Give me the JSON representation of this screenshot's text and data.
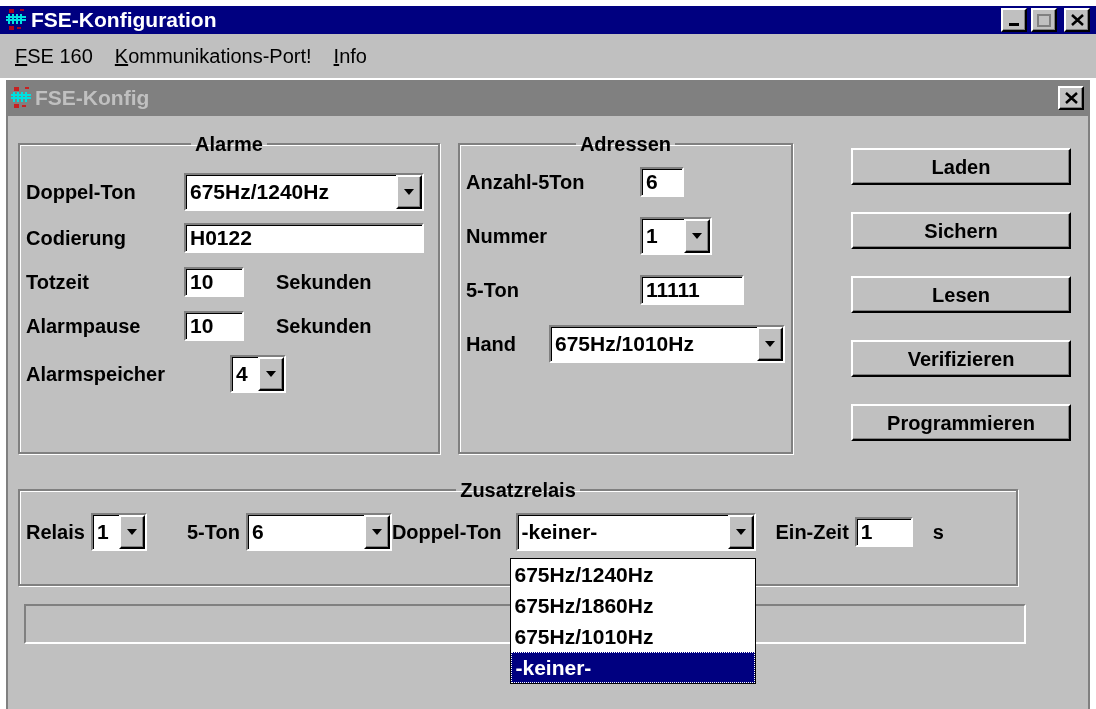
{
  "window": {
    "title": "FSE-Konfiguration"
  },
  "menu": [
    {
      "label": "FSE 160"
    },
    {
      "label": "Kommunikations-Port!"
    },
    {
      "label": "Info"
    }
  ],
  "child_window": {
    "title": "FSE-Konfig",
    "active": false
  },
  "alarme": {
    "title": "Alarme",
    "rows": [
      {
        "kind": "combo",
        "label": "Doppel-Ton",
        "value": "675Hz/1240Hz"
      },
      {
        "kind": "text",
        "label": "Codierung",
        "value": "H0122"
      },
      {
        "kind": "text",
        "label": "Totzeit",
        "value": "10",
        "unit": "Sekunden"
      },
      {
        "kind": "text",
        "label": "Alarmpause",
        "value": "10",
        "unit": "Sekunden"
      },
      {
        "kind": "combo",
        "label": "Alarmspeicher",
        "value": "4"
      }
    ]
  },
  "adressen": {
    "title": "Adressen",
    "rows": [
      {
        "kind": "text",
        "label": "Anzahl-5Ton",
        "value": "6"
      },
      {
        "kind": "combo",
        "label": "Nummer",
        "value": "1"
      },
      {
        "kind": "text",
        "label": "5-Ton",
        "value": "11111"
      },
      {
        "kind": "combo",
        "label": "Hand",
        "value": "675Hz/1010Hz"
      }
    ]
  },
  "buttons": [
    "Laden",
    "Sichern",
    "Lesen",
    "Verifizieren",
    "Programmieren"
  ],
  "zusatzrelais": {
    "title": "Zusatzrelais",
    "items": [
      {
        "kind": "combo",
        "label": "Relais",
        "value": "1"
      },
      {
        "kind": "combo",
        "label": "5-Ton",
        "value": "6"
      },
      {
        "kind": "combo",
        "label": "Doppel-Ton",
        "value": "-keiner-",
        "options": [
          {
            "label": "675Hz/1240Hz",
            "selected": false
          },
          {
            "label": "675Hz/1860Hz",
            "selected": false
          },
          {
            "label": "675Hz/1010Hz",
            "selected": false
          },
          {
            "label": "-keiner-",
            "selected": true
          }
        ]
      },
      {
        "kind": "text",
        "label": "Ein-Zeit",
        "value": "1",
        "unit": "s"
      }
    ]
  }
}
